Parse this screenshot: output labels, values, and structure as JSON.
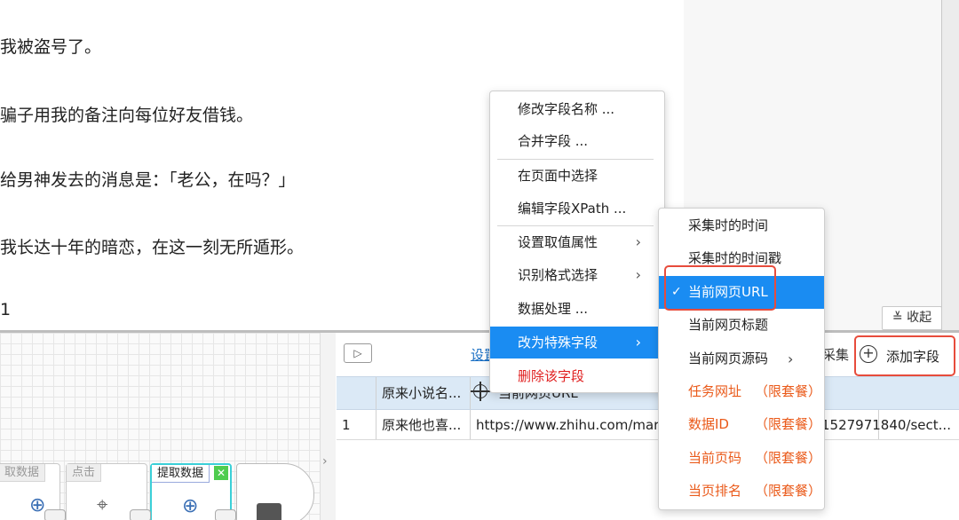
{
  "article": {
    "paragraphs": [
      "我被盗号了。",
      "骗子用我的备注向每位好友借钱。",
      "给男神发去的消息是：「老公，在吗？」",
      "我长达十年的暗恋，在这一刻无所遁形。",
      "1"
    ]
  },
  "context_menu": {
    "items": [
      {
        "label": "修改字段名称 ..."
      },
      {
        "label": "合并字段 ..."
      },
      {
        "label": "在页面中选择"
      },
      {
        "label": "编辑字段XPath ..."
      },
      {
        "label": "设置取值属性",
        "submenu": true
      },
      {
        "label": "识别格式选择",
        "submenu": true
      },
      {
        "label": "数据处理 ..."
      },
      {
        "label": "改为特殊字段",
        "submenu": true,
        "highlighted": true
      },
      {
        "label": "删除该字段",
        "danger": true
      }
    ]
  },
  "submenu": {
    "items": [
      {
        "label": "采集时的时间"
      },
      {
        "label": "采集时的时间戳"
      },
      {
        "label": "当前网页URL",
        "highlighted": true,
        "checked": true
      },
      {
        "label": "当前网页标题"
      },
      {
        "label": "当前网页源码",
        "submenu": true
      },
      {
        "label": "任务网址",
        "package": "（限套餐）"
      },
      {
        "label": "数据ID",
        "package": "（限套餐）"
      },
      {
        "label": "当前页码",
        "package": "（限套餐）"
      },
      {
        "label": "当页排名",
        "package": "（限套餐）"
      }
    ],
    "check_mark": "✓",
    "chevron": "›"
  },
  "toolbar": {
    "collapse_label": "收起",
    "collapse_icon": "double-chevron-down-icon",
    "play_icon": "▷",
    "settings_label": "设置",
    "collect_label": "采集",
    "add_field_label": "添加字段",
    "add_icon": "+"
  },
  "table": {
    "headers": [
      "",
      "原来小说名...",
      "当前网页URL"
    ],
    "rows": [
      {
        "index": "1",
        "col1": "原来他也喜...",
        "col2": "https://www.zhihu.com/marke",
        "col3": "1527971840/sect..."
      }
    ]
  },
  "workflow": {
    "nodes": [
      {
        "label": "取数据"
      },
      {
        "label": "点击"
      },
      {
        "label": "提取数据",
        "active": true
      }
    ],
    "close_icon": "✕",
    "expand_arrow": "›"
  },
  "colors": {
    "menu_highlight": "#1a8cf2",
    "danger": "#e02020",
    "package_orange": "#ea5a1a",
    "annotation_red": "#e74c3c",
    "table_header": "#dbe9f6"
  }
}
